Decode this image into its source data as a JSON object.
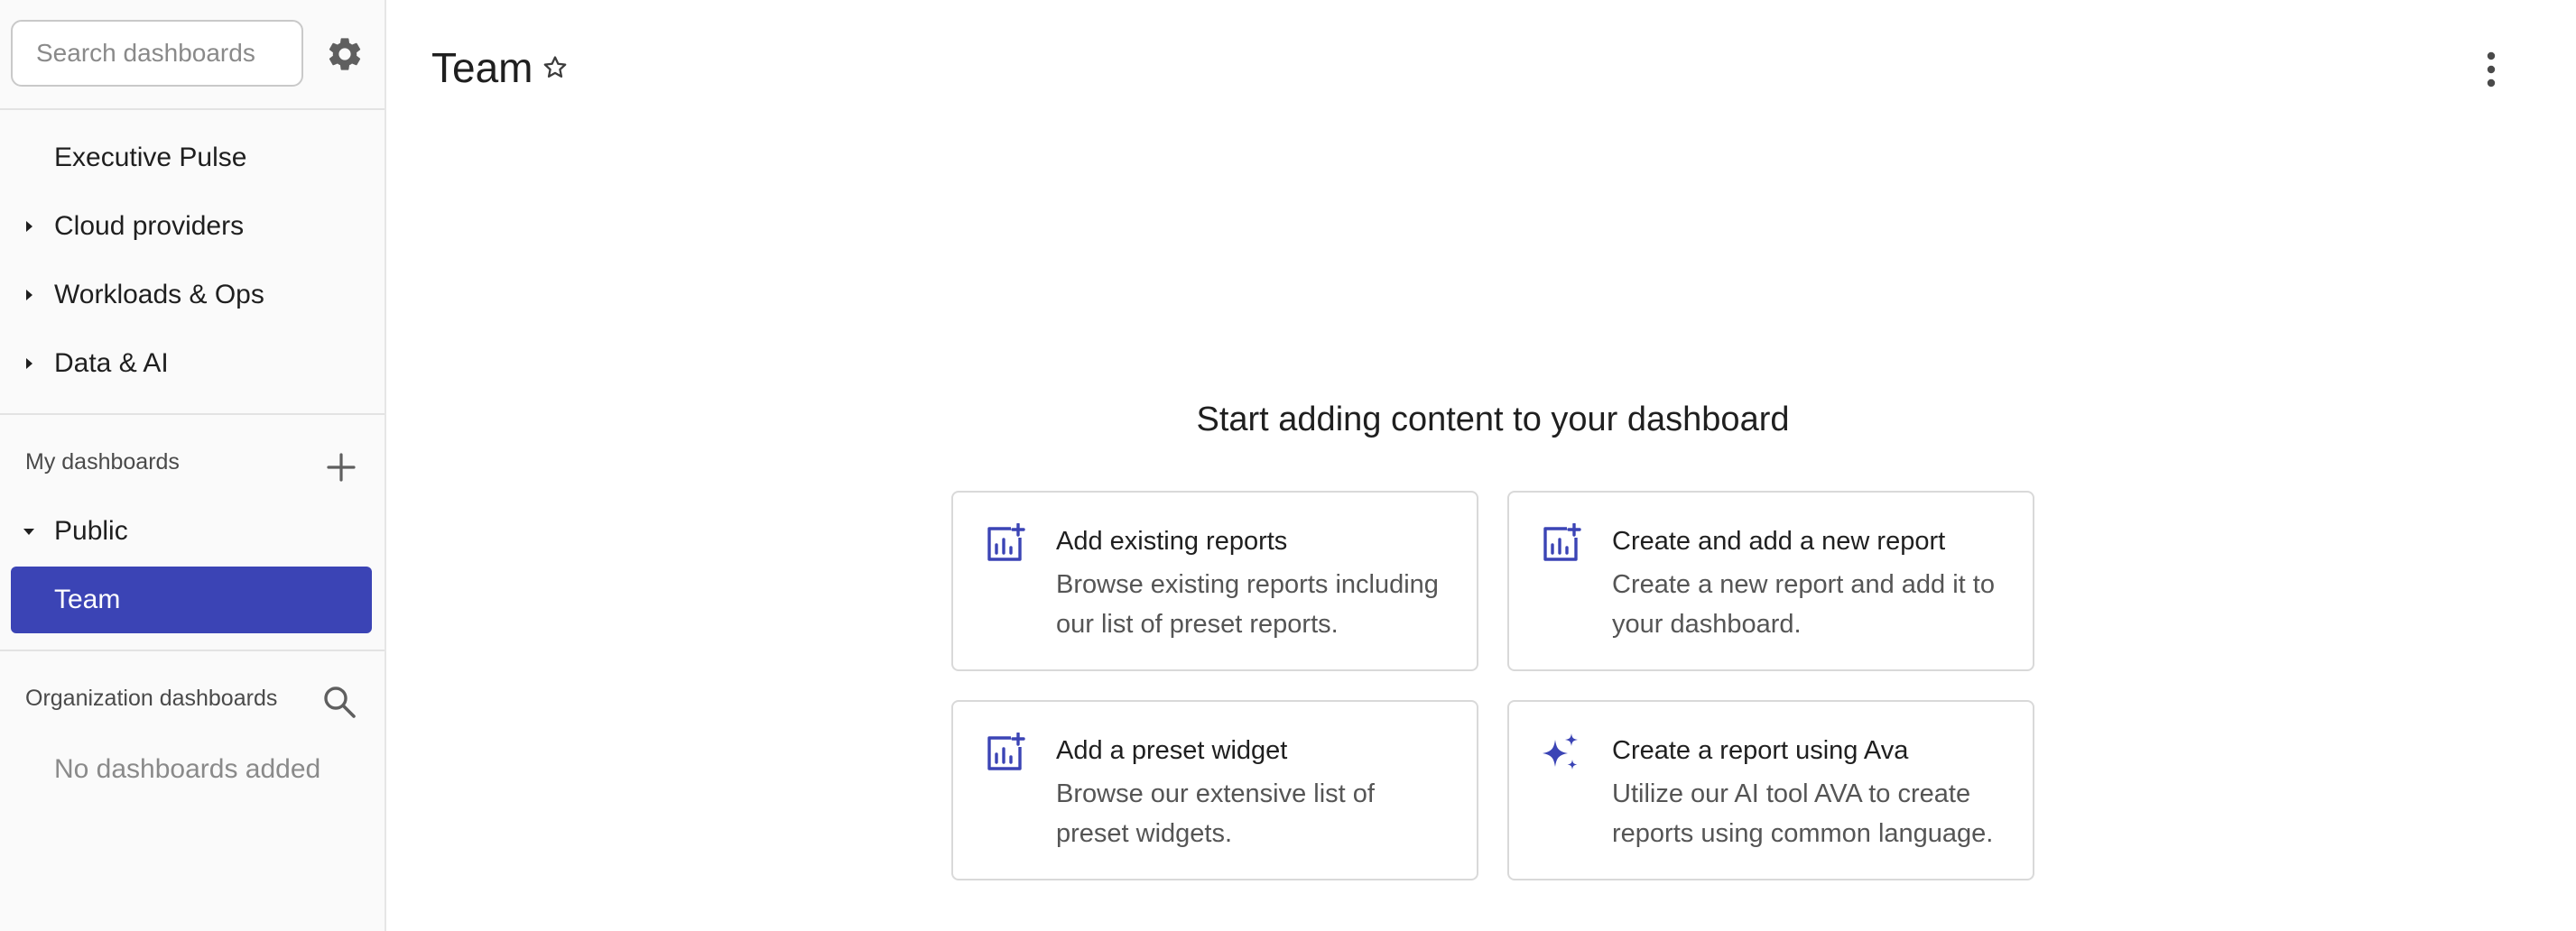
{
  "sidebar": {
    "search": {
      "placeholder": "Search dashboards",
      "value": ""
    },
    "settings_icon": "gear-icon",
    "items": [
      {
        "label": "Executive Pulse",
        "expandable": false
      },
      {
        "label": "Cloud providers",
        "expandable": true,
        "expanded": false
      },
      {
        "label": "Workloads & Ops",
        "expandable": true,
        "expanded": false
      },
      {
        "label": "Data & AI",
        "expandable": true,
        "expanded": false
      }
    ],
    "my_dashboards": {
      "label": "My dashboards",
      "add_icon": "plus-icon",
      "group": {
        "label": "Public",
        "expanded": true
      },
      "active_item": {
        "label": "Team"
      }
    },
    "org_dashboards": {
      "label": "Organization dashboards",
      "search_icon": "search-icon",
      "empty_text": "No dashboards added"
    }
  },
  "header": {
    "title": "Team",
    "favorite_icon": "star-outline-icon",
    "menu_icon": "more-vertical-icon"
  },
  "empty_state": {
    "heading": "Start adding content to your dashboard",
    "cards": [
      {
        "title": "Add existing reports",
        "description": "Browse existing reports including our list of preset reports.",
        "icon": "chart-add-icon"
      },
      {
        "title": "Create and add a new report",
        "description": "Create a new report and add it to your dashboard.",
        "icon": "chart-add-icon"
      },
      {
        "title": "Add a preset widget",
        "description": "Browse our extensive list of preset widgets.",
        "icon": "chart-add-icon"
      },
      {
        "title": "Create a report using Ava",
        "description": "Utilize our AI tool AVA to create reports using common language.",
        "icon": "sparkle-icon"
      }
    ]
  },
  "colors": {
    "accent": "#3b44b5",
    "sidebar_bg": "#fafafa",
    "border": "#d9d9d9",
    "muted_text": "#8a8a8a"
  }
}
